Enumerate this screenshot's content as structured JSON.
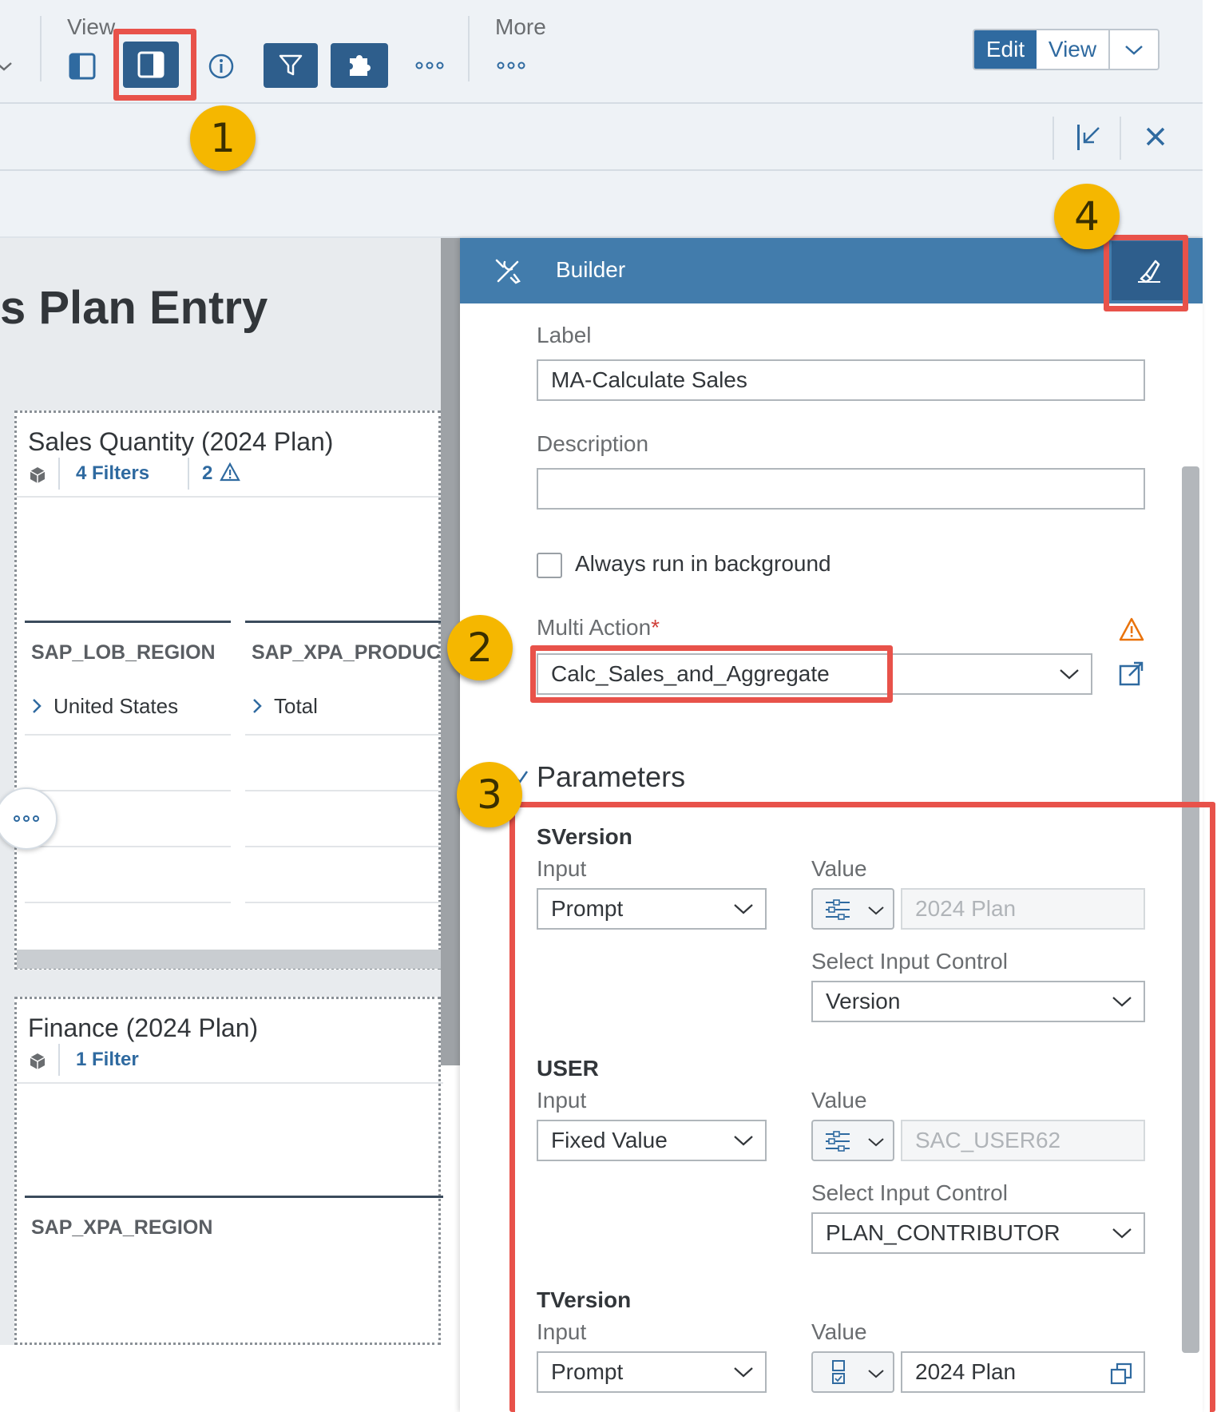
{
  "toolbar": {
    "view_label": "View",
    "more_label": "More",
    "segment": {
      "edit": "Edit",
      "view": "View"
    }
  },
  "badges": {
    "one": "1",
    "two": "2",
    "three": "3",
    "four": "4"
  },
  "canvas": {
    "page_title": "s Plan Entry",
    "card1": {
      "title": "Sales Quantity (2024 Plan)",
      "filters": "4 Filters",
      "warnings": "2",
      "col1": "SAP_LOB_REGION",
      "col2": "SAP_XPA_PRODUC",
      "row1_col1": "United States",
      "row1_col2": "Total"
    },
    "card2": {
      "title": "Finance (2024 Plan)",
      "filters": "1 Filter",
      "col1": "SAP_XPA_REGION"
    }
  },
  "builder": {
    "title": "Builder",
    "label_field": {
      "label": "Label",
      "value": "MA-Calculate Sales"
    },
    "description_field": {
      "label": "Description",
      "value": ""
    },
    "background_checkbox": {
      "label": "Always run in background",
      "checked": false
    },
    "multi_action": {
      "label": "Multi Action",
      "required_marker": "*",
      "value": "Calc_Sales_and_Aggregate"
    },
    "parameters_title": "Parameters",
    "parameters": [
      {
        "name": "SVersion",
        "input_label": "Input",
        "input_value": "Prompt",
        "value_label": "Value",
        "value": "2024 Plan",
        "control_label": "Select Input Control",
        "control_value": "Version"
      },
      {
        "name": "USER",
        "input_label": "Input",
        "input_value": "Fixed Value",
        "value_label": "Value",
        "value": "SAC_USER62",
        "control_label": "Select Input Control",
        "control_value": "PLAN_CONTRIBUTOR"
      },
      {
        "name": "TVersion",
        "input_label": "Input",
        "input_value": "Prompt",
        "value_label": "Value",
        "value": "2024 Plan"
      }
    ]
  },
  "colors": {
    "accent": "#2f6aa0",
    "panel_header": "#427cac",
    "highlight": "#e8524a",
    "badge": "#f5b700",
    "warning": "#e9730c"
  }
}
